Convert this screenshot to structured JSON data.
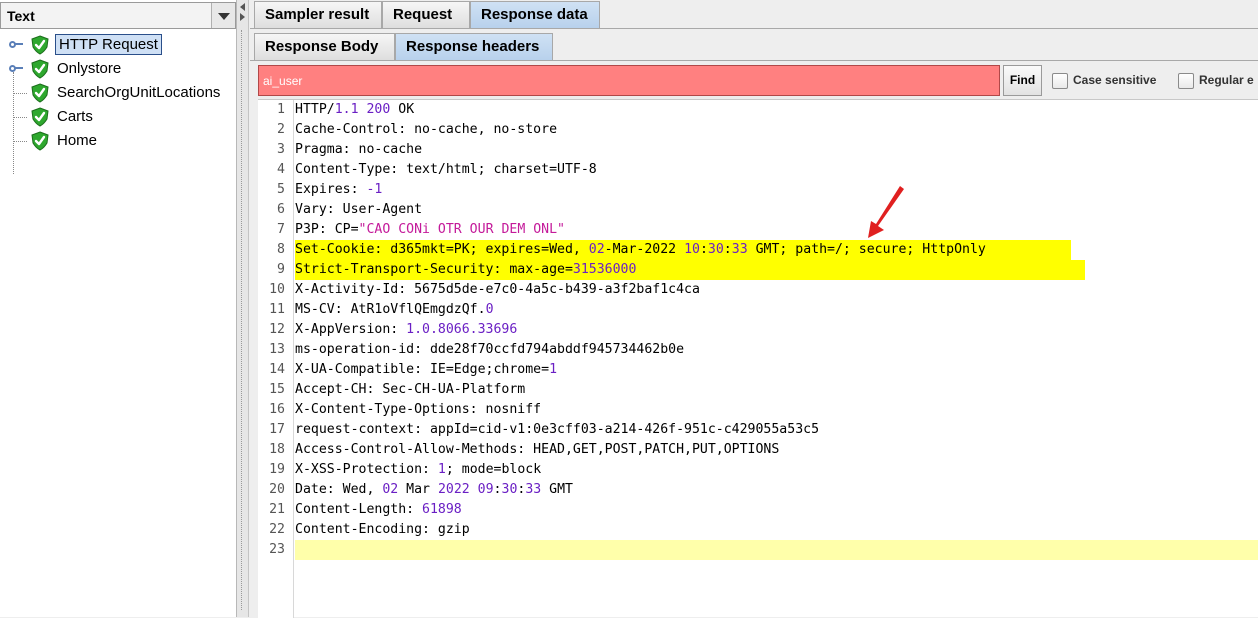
{
  "left_panel": {
    "renderer_select": "Text",
    "tree": [
      {
        "label": "HTTP Request",
        "selected": true,
        "expandable": true
      },
      {
        "label": "Onlystore",
        "selected": false,
        "expandable": true
      },
      {
        "label": "SearchOrgUnitLocations",
        "selected": false,
        "expandable": false
      },
      {
        "label": "Carts",
        "selected": false,
        "expandable": false
      },
      {
        "label": "Home",
        "selected": false,
        "expandable": false
      }
    ]
  },
  "tabs_main": [
    "Sampler result",
    "Request",
    "Response data"
  ],
  "tabs_main_active": "Response data",
  "tabs_sub": [
    "Response Body",
    "Response headers"
  ],
  "tabs_sub_active": "Response headers",
  "search": {
    "value": "ai_user",
    "find_label": "Find",
    "case_sensitive_label": "Case sensitive",
    "regex_label": "Regular e"
  },
  "code_lines": [
    "HTTP/1.1 200 OK",
    "Cache-Control: no-cache, no-store",
    "Pragma: no-cache",
    "Content-Type: text/html; charset=UTF-8",
    "Expires: -1",
    "Vary: User-Agent",
    "P3P: CP=\"CAO CONi OTR OUR DEM ONL\"",
    "Set-Cookie: d365mkt=PK; expires=Wed, 02-Mar-2022 10:30:33 GMT; path=/; secure; HttpOnly",
    "Strict-Transport-Security: max-age=31536000",
    "X-Activity-Id: 5675d5de-e7c0-4a5c-b439-a3f2baf1c4ca",
    "MS-CV: AtR1oVflQEmgdzQf.0",
    "X-AppVersion: 1.0.8066.33696",
    "ms-operation-id: dde28f70ccfd794abddf945734462b0e",
    "X-UA-Compatible: IE=Edge;chrome=1",
    "Accept-CH: Sec-CH-UA-Platform",
    "X-Content-Type-Options: nosniff",
    "request-context: appId=cid-v1:0e3cff03-a214-426f-951c-c429055a53c5",
    "Access-Control-Allow-Methods: HEAD,GET,POST,PATCH,PUT,OPTIONS",
    "X-XSS-Protection: 1; mode=block",
    "Date: Wed, 02 Mar 2022 09:30:33 GMT",
    "Content-Length: 61898",
    "Content-Encoding: gzip",
    ""
  ],
  "colors": {
    "search_bg": "#ff8080",
    "highlight_yellow": "#ffff00",
    "current_line": "#ffffaa",
    "number_purple": "#6a1fc4",
    "string_magenta": "#c41a9a",
    "arrow_red": "#e02020"
  }
}
